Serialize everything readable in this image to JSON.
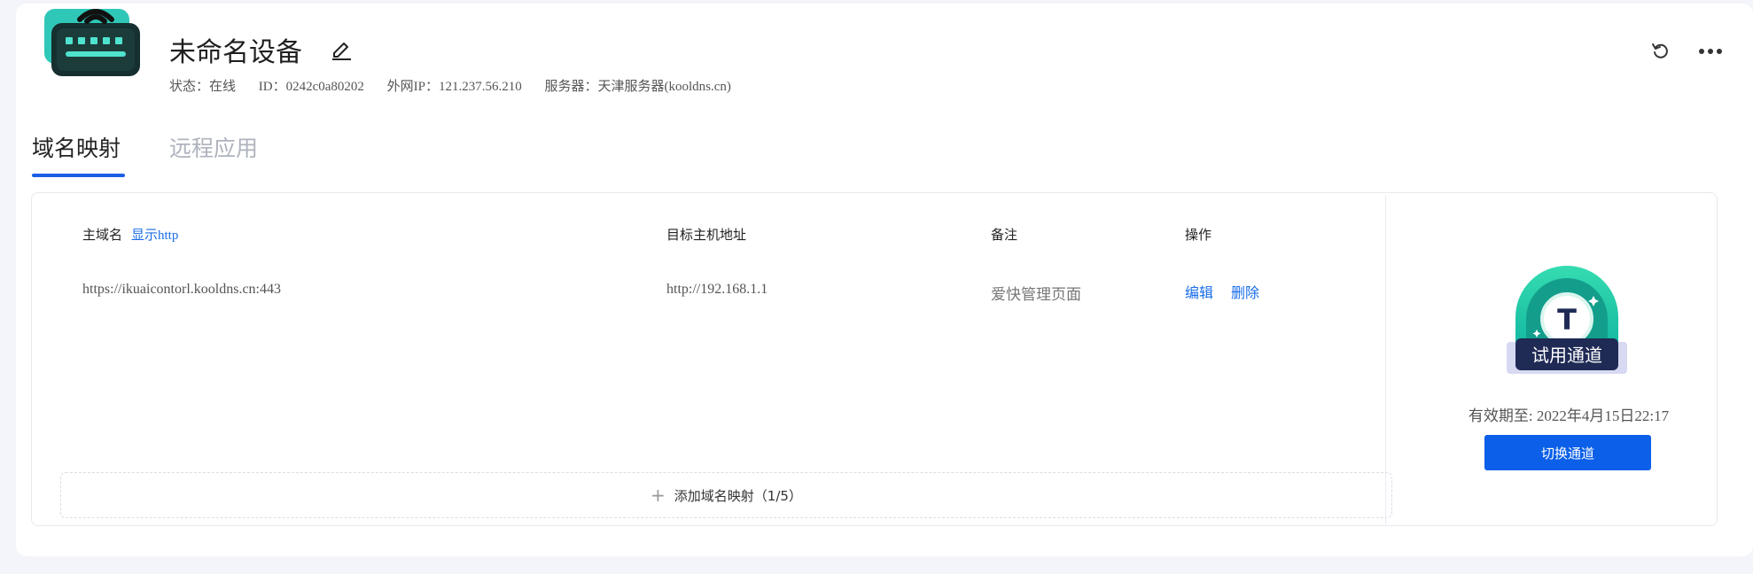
{
  "device": {
    "name": "未命名设备",
    "status": "状态：在线",
    "id": "ID：0242c0a80202",
    "public_ip": "外网IP：121.237.56.210",
    "server": "服务器：天津服务器(kooldns.cn)"
  },
  "tabs": [
    {
      "label": "域名映射",
      "active": true
    },
    {
      "label": "远程应用",
      "active": false
    }
  ],
  "table": {
    "headers": {
      "hostname": "主域名",
      "show_http": "显示http",
      "target": "目标主机地址",
      "note": "备注",
      "actions": "操作"
    },
    "rows": [
      {
        "hostname": "https://ikuaicontorl.kooldns.cn:443",
        "target": "http://192.168.1.1",
        "note": "爱快管理页面",
        "edit": "编辑",
        "delete": "删除"
      }
    ]
  },
  "add_mapping": "添加域名映射（1/5）",
  "channel": {
    "badge_text": "试用通道",
    "badge_letter": "T",
    "validity": "有效期至: 2022年4月15日22:17",
    "switch_button": "切换通道"
  },
  "colors": {
    "accent": "#1a5fe6",
    "link": "#1a6ee8",
    "badge_green": "#1ec9a0",
    "badge_navy": "#1f2a55",
    "device_teal": "#2fc7b8"
  },
  "icons": {
    "device": "router-icon",
    "edit": "edit-icon",
    "refresh": "refresh-icon",
    "more": "more-icon",
    "add": "plus-icon"
  }
}
